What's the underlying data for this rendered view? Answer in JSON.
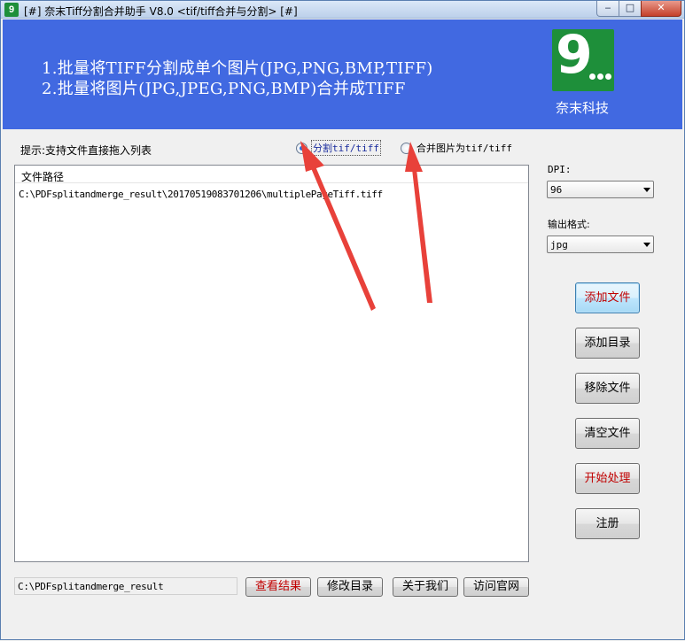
{
  "window": {
    "title": "[#] 奈末Tiff分割合并助手 V8.0 <tif/tiff合并与分割> [#]",
    "icon_letter": "9",
    "controls": {
      "minimize": "‒",
      "maximize": "□",
      "close": "✕"
    }
  },
  "banner": {
    "line1": "1.批量将TIFF分割成单个图片(JPG,PNG,BMP,TIFF)",
    "line2": "2.批量将图片(JPG,JPEG,PNG,BMP)合并成TIFF",
    "logo_text": "9",
    "company": "奈末科技",
    "bg_color": "#4169e1",
    "logo_color": "#1e8f3a"
  },
  "hint": "提示:支持文件直接拖入列表",
  "mode": {
    "options": [
      {
        "label": "分割tif/tiff",
        "selected": true
      },
      {
        "label": "合并图片为tif/tiff",
        "selected": false
      }
    ]
  },
  "file_list": {
    "header": "文件路径",
    "rows": [
      "C:\\PDFsplitandmerge_result\\20170519083701206\\multiplePageTiff.tiff"
    ]
  },
  "settings": {
    "dpi_label": "DPI:",
    "dpi_value": "96",
    "format_label": "输出格式:",
    "format_value": "jpg"
  },
  "side_buttons": {
    "add_file": "添加文件",
    "add_dir": "添加目录",
    "remove_file": "移除文件",
    "clear_files": "清空文件",
    "start": "开始处理",
    "register": "注册"
  },
  "bottom": {
    "output_path": "C:\\PDFsplitandmerge_result",
    "view_result": "查看结果",
    "change_dir": "修改目录",
    "about": "关于我们",
    "website": "访问官网"
  },
  "annotation_color": "#e8413a"
}
